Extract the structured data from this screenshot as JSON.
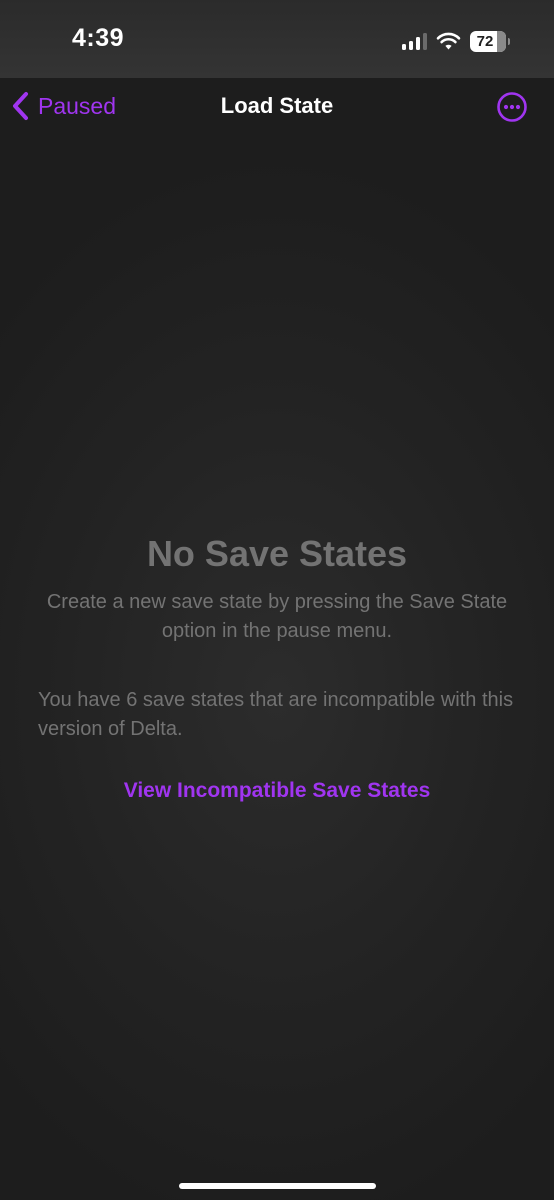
{
  "status_bar": {
    "time": "4:39",
    "battery_level": "72",
    "signal_bars_active": 3,
    "signal_bars_total": 4,
    "wifi": "wifi-icon"
  },
  "nav": {
    "back_label": "Paused",
    "title": "Load State",
    "more_icon": "ellipsis-circle-icon"
  },
  "empty_state": {
    "title": "No Save States",
    "description": "Create a new save state by pressing the Save State option in the pause menu.",
    "incompatible_text": "You have 6 save states that are incompatible with this version of Delta.",
    "view_link": "View Incompatible Save States"
  },
  "colors": {
    "accent": "#a035f0",
    "background": "#232323",
    "muted_text": "#737373"
  }
}
